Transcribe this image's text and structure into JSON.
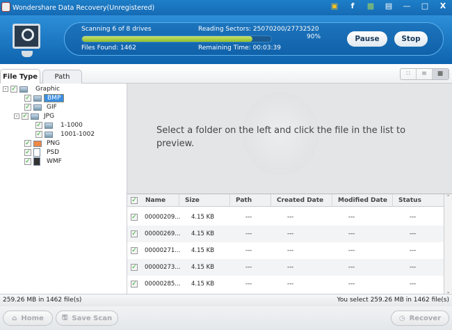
{
  "window": {
    "title": "Wondershare Data Recovery(Unregistered)",
    "icons": [
      "cart-icon",
      "facebook-icon",
      "chat-icon",
      "register-icon",
      "minimize-icon",
      "maximize-icon",
      "close-icon"
    ]
  },
  "scan": {
    "status": "Scanning 6 of 8 drives",
    "sectors": "Reading Sectors: 25070200/27732520",
    "progress_percent": 90,
    "percent_label": "90%",
    "files_found": "Files Found: 1462",
    "remaining": "Remaining Time: 00:03:39",
    "pause": "Pause",
    "stop": "Stop"
  },
  "tabs": [
    {
      "label": "File Type"
    },
    {
      "label": "Path"
    }
  ],
  "tree": {
    "root": "Graphic",
    "items": [
      {
        "label": "BMP"
      },
      {
        "label": "GIF"
      },
      {
        "label": "JPG"
      },
      {
        "label": "1-1000"
      },
      {
        "label": "1001-1002"
      },
      {
        "label": "PNG"
      },
      {
        "label": "PSD"
      },
      {
        "label": "WMF"
      }
    ]
  },
  "preview": {
    "message": "Select a folder on the left and click the file in the list to preview."
  },
  "table": {
    "columns": [
      "Name",
      "Size",
      "Path",
      "Created Date",
      "Modified Date",
      "Status"
    ],
    "rows": [
      {
        "name": "00000209...",
        "size": "4.15 KB",
        "path": "---",
        "created": "---",
        "modified": "---",
        "status": "---"
      },
      {
        "name": "00000269...",
        "size": "4.15 KB",
        "path": "---",
        "created": "---",
        "modified": "---",
        "status": "---"
      },
      {
        "name": "00000271...",
        "size": "4.15 KB",
        "path": "---",
        "created": "---",
        "modified": "---",
        "status": "---"
      },
      {
        "name": "00000273...",
        "size": "4.15 KB",
        "path": "---",
        "created": "---",
        "modified": "---",
        "status": "---"
      },
      {
        "name": "00000285...",
        "size": "4.15 KB",
        "path": "---",
        "created": "---",
        "modified": "---",
        "status": "---"
      }
    ]
  },
  "statusbar": {
    "left": "259.26 MB in 1462 file(s)",
    "right": "You select 259.26 MB in 1462 file(s)"
  },
  "buttons": {
    "home": "Home",
    "save_scan": "Save Scan",
    "recover": "Recover"
  }
}
